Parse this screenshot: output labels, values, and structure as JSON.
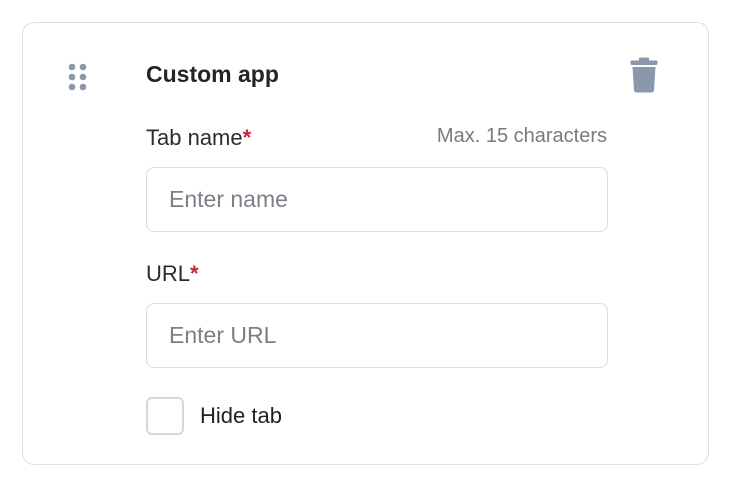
{
  "card": {
    "title": "Custom app",
    "drag_icon": "drag-handle-icon",
    "delete_icon": "trash-icon"
  },
  "tab_name": {
    "label": "Tab name",
    "required_mark": "*",
    "hint": "Max. 15 characters",
    "placeholder": "Enter name",
    "value": ""
  },
  "url": {
    "label": "URL",
    "required_mark": "*",
    "placeholder": "Enter URL",
    "value": ""
  },
  "hide_tab": {
    "label": "Hide tab",
    "checked": false
  },
  "colors": {
    "required": "#d0213d",
    "icon": "#8a98ab",
    "border": "#dcdfe4"
  }
}
